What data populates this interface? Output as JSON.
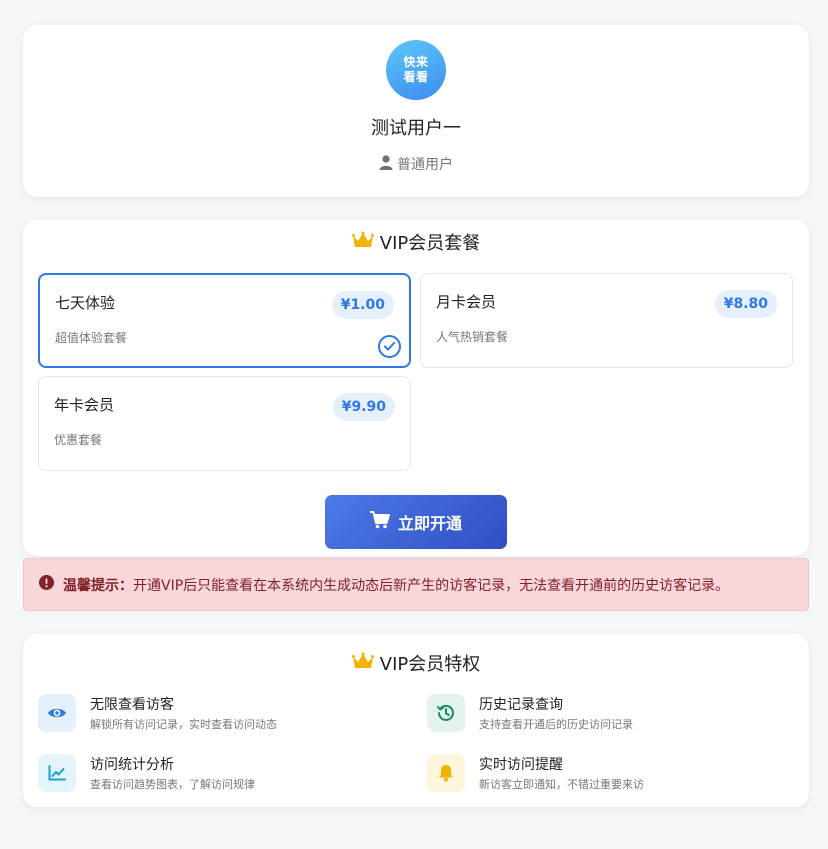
{
  "profile": {
    "avatar_line1": "快来",
    "avatar_line2": "看看",
    "name": "测试用户一",
    "role": "普通用户"
  },
  "packages": {
    "title": "VIP会员套餐",
    "plans": [
      {
        "name": "七天体验",
        "desc": "超值体验套餐",
        "price": "¥1.00",
        "selected": true
      },
      {
        "name": "月卡会员",
        "desc": "人气热销套餐",
        "price": "¥8.80",
        "selected": false
      },
      {
        "name": "年卡会员",
        "desc": "优惠套餐",
        "price": "¥9.90",
        "selected": false
      }
    ],
    "button_label": "立即开通"
  },
  "warning": {
    "label": "温馨提示：",
    "text": "开通VIP后只能查看在本系统内生成动态后新产生的访客记录，无法查看开通前的历史访客记录。"
  },
  "privileges": {
    "title": "VIP会员特权",
    "items": [
      {
        "title": "无限查看访客",
        "desc": "解锁所有访问记录，实时查看访问动态",
        "icon": "eye-icon",
        "color": "#2f78e6"
      },
      {
        "title": "历史记录查询",
        "desc": "支持查看开通后的历史访问记录",
        "icon": "history-icon",
        "color": "#1e8a5a"
      },
      {
        "title": "访问统计分析",
        "desc": "查看访问趋势图表，了解访问规律",
        "icon": "chart-line-icon",
        "color": "#1aa3c8"
      },
      {
        "title": "实时访问提醒",
        "desc": "新访客立即通知，不错过重要来访",
        "icon": "bell-icon",
        "color": "#f0b400"
      }
    ]
  },
  "colors": {
    "accent": "#2f78e6",
    "crown": "#f0b400",
    "warning_bg": "#f8d7da",
    "warning_text": "#842029"
  }
}
